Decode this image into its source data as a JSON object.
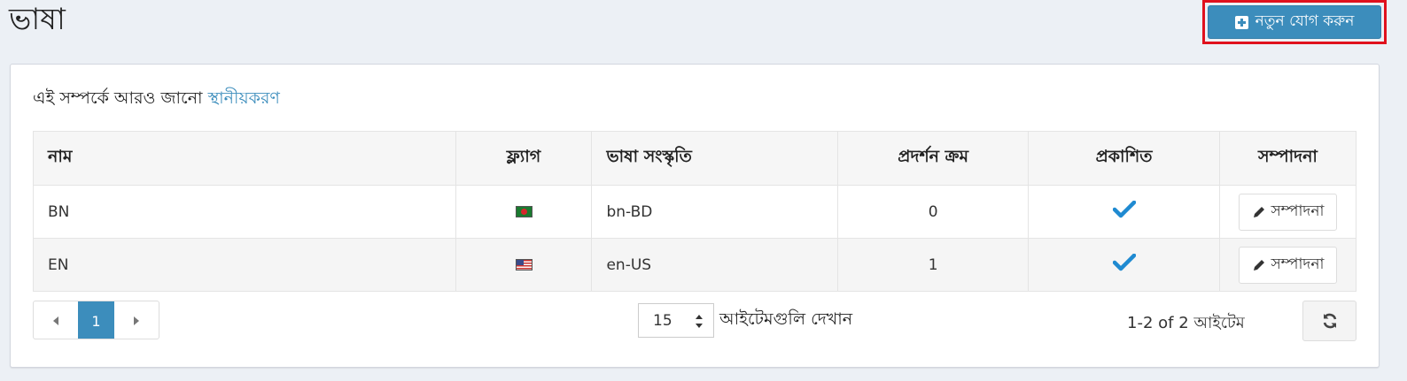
{
  "page": {
    "title": "ভাষা"
  },
  "toolbar": {
    "add_label": "নতুন যোগ করুন"
  },
  "info": {
    "learn_more_prefix": "এই সম্পর্কে আরও জানো",
    "learn_more_link": "স্থানীয়করণ"
  },
  "table": {
    "headers": [
      "নাম",
      "ফ্ল্যাগ",
      "ভাষা সংস্কৃতি",
      "প্রদর্শন ক্রম",
      "প্রকাশিত",
      "সম্পাদনা"
    ],
    "rows": [
      {
        "name": "BN",
        "flag": "flag-bd-icon",
        "culture": "bn-BD",
        "order": "0",
        "published": true,
        "edit_label": "সম্পাদনা"
      },
      {
        "name": "EN",
        "flag": "flag-us-icon",
        "culture": "en-US",
        "order": "1",
        "published": true,
        "edit_label": "সম্পাদনা"
      }
    ]
  },
  "pager": {
    "current_page": "1",
    "page_size": "15",
    "show_items_label": "আইটেমগুলি দেখান",
    "item_count": "1-2 of 2 আইটেম"
  },
  "colors": {
    "accent": "#3c8dbc",
    "highlight_border": "#e0111d",
    "check": "#1f8ad1"
  }
}
